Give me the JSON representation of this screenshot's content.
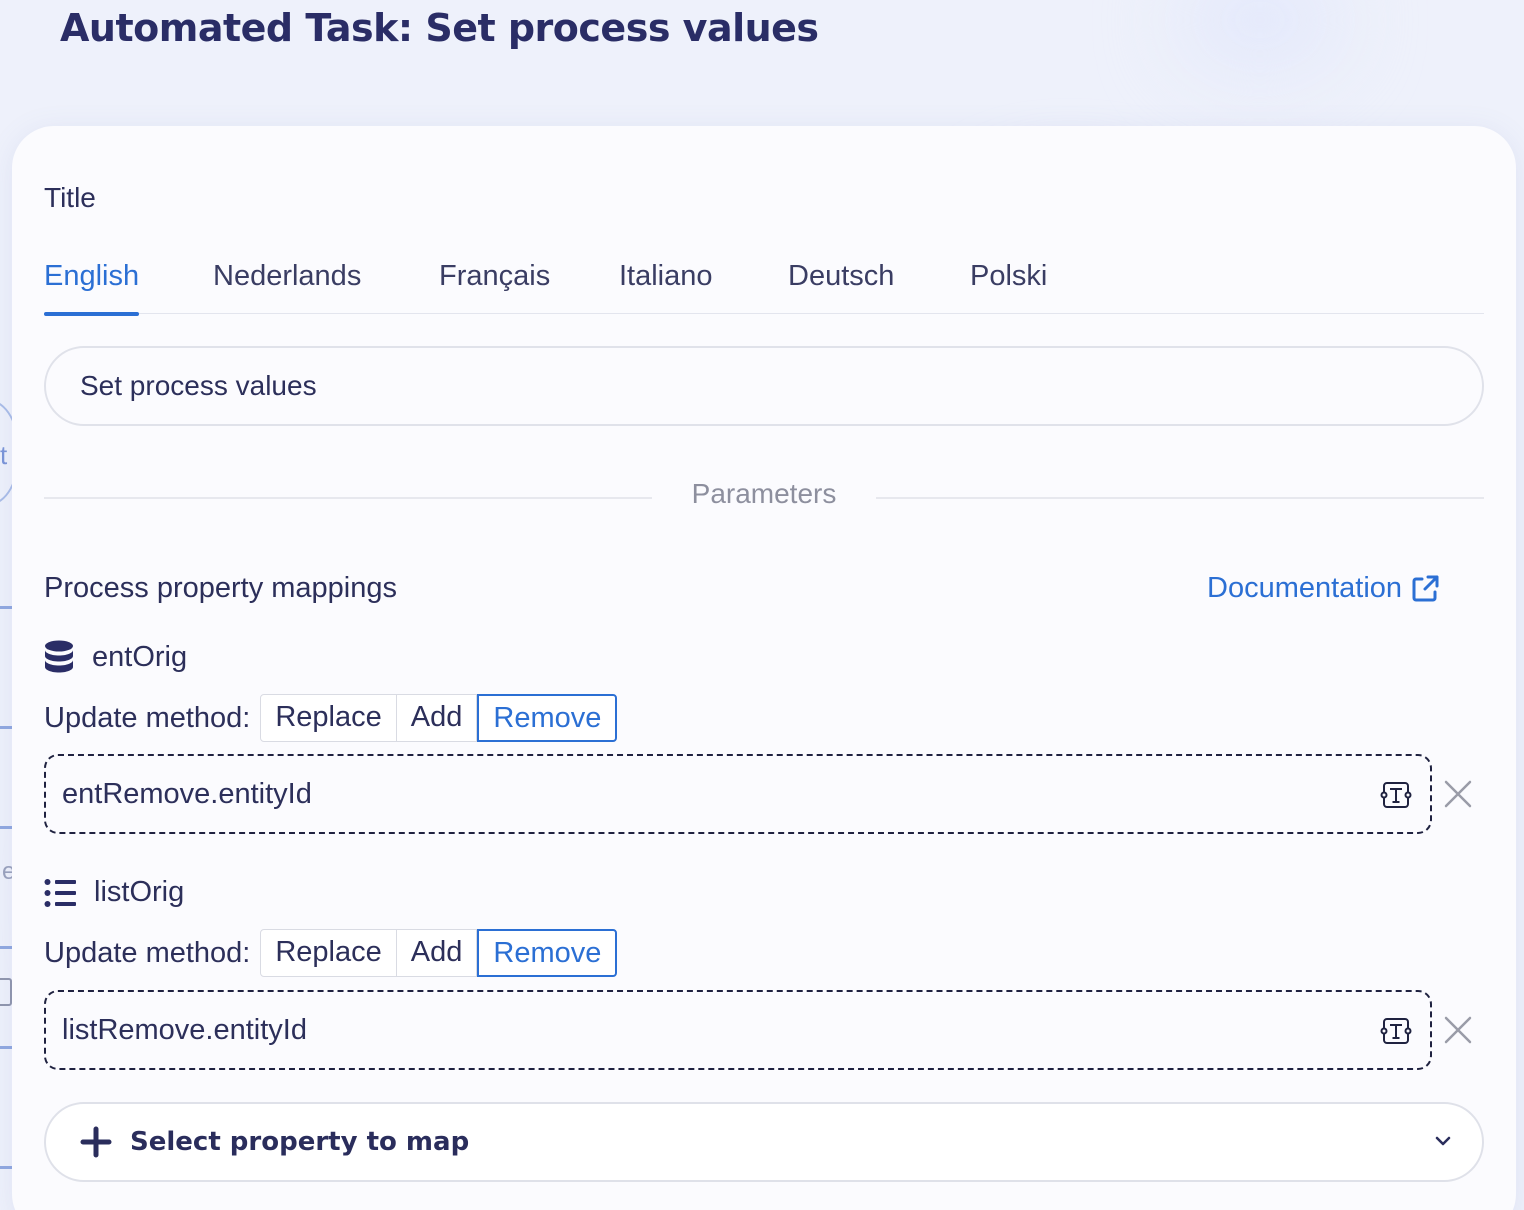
{
  "header": {
    "title": "Automated Task: Set process values"
  },
  "canvas_fragments": {
    "letter_t": "t",
    "letter_e": "e"
  },
  "form": {
    "title_label": "Title",
    "language_tabs": [
      {
        "label": "English",
        "active": true
      },
      {
        "label": "Nederlands",
        "active": false
      },
      {
        "label": "Français",
        "active": false
      },
      {
        "label": "Italiano",
        "active": false
      },
      {
        "label": "Deutsch",
        "active": false
      },
      {
        "label": "Polski",
        "active": false
      }
    ],
    "title_value": "Set process values",
    "parameters_label": "Parameters",
    "mappings_heading": "Process property mappings",
    "documentation_link": "Documentation",
    "mappings": [
      {
        "property": "entOrig",
        "icon": "database-icon",
        "update_method_label": "Update method:",
        "methods": [
          "Replace",
          "Add",
          "Remove"
        ],
        "selected_method": "Remove",
        "value": "entRemove.entityId"
      },
      {
        "property": "listOrig",
        "icon": "list-icon",
        "update_method_label": "Update method:",
        "methods": [
          "Replace",
          "Add",
          "Remove"
        ],
        "selected_method": "Remove",
        "value": "listRemove.entityId"
      }
    ],
    "select_property_label": "Select property to map"
  },
  "colors": {
    "accent": "#2b6fd4",
    "title": "#2a2d66",
    "text": "#2c2f5a",
    "background": "#eef1fb",
    "card": "#fbfbfe"
  }
}
